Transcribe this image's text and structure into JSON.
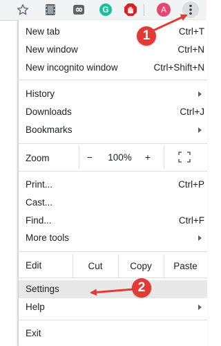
{
  "toolbar": {
    "avatar_letter": "A",
    "grammarly_letter": "G",
    "colors": {
      "toolbar_bg": "#f2f3f5",
      "avatar_bg": "#e8466e",
      "grammarly_bg": "#15c39a",
      "stop_ext": "#e02020"
    }
  },
  "menu": {
    "new_tab": {
      "label": "New tab",
      "shortcut": "Ctrl+T"
    },
    "new_window": {
      "label": "New window",
      "shortcut": "Ctrl+N"
    },
    "new_incognito": {
      "label": "New incognito window",
      "shortcut": "Ctrl+Shift+N"
    },
    "history": {
      "label": "History"
    },
    "downloads": {
      "label": "Downloads",
      "shortcut": "Ctrl+J"
    },
    "bookmarks": {
      "label": "Bookmarks"
    },
    "zoom": {
      "label": "Zoom",
      "minus": "−",
      "value": "100%",
      "plus": "+"
    },
    "print": {
      "label": "Print...",
      "shortcut": "Ctrl+P"
    },
    "cast": {
      "label": "Cast..."
    },
    "find": {
      "label": "Find...",
      "shortcut": "Ctrl+F"
    },
    "more_tools": {
      "label": "More tools"
    },
    "edit": {
      "label": "Edit",
      "cut": "Cut",
      "copy": "Copy",
      "paste": "Paste"
    },
    "settings": {
      "label": "Settings"
    },
    "help": {
      "label": "Help"
    },
    "exit": {
      "label": "Exit"
    }
  },
  "annotations": {
    "step1": "1",
    "step2": "2",
    "color": "#e23b35"
  }
}
